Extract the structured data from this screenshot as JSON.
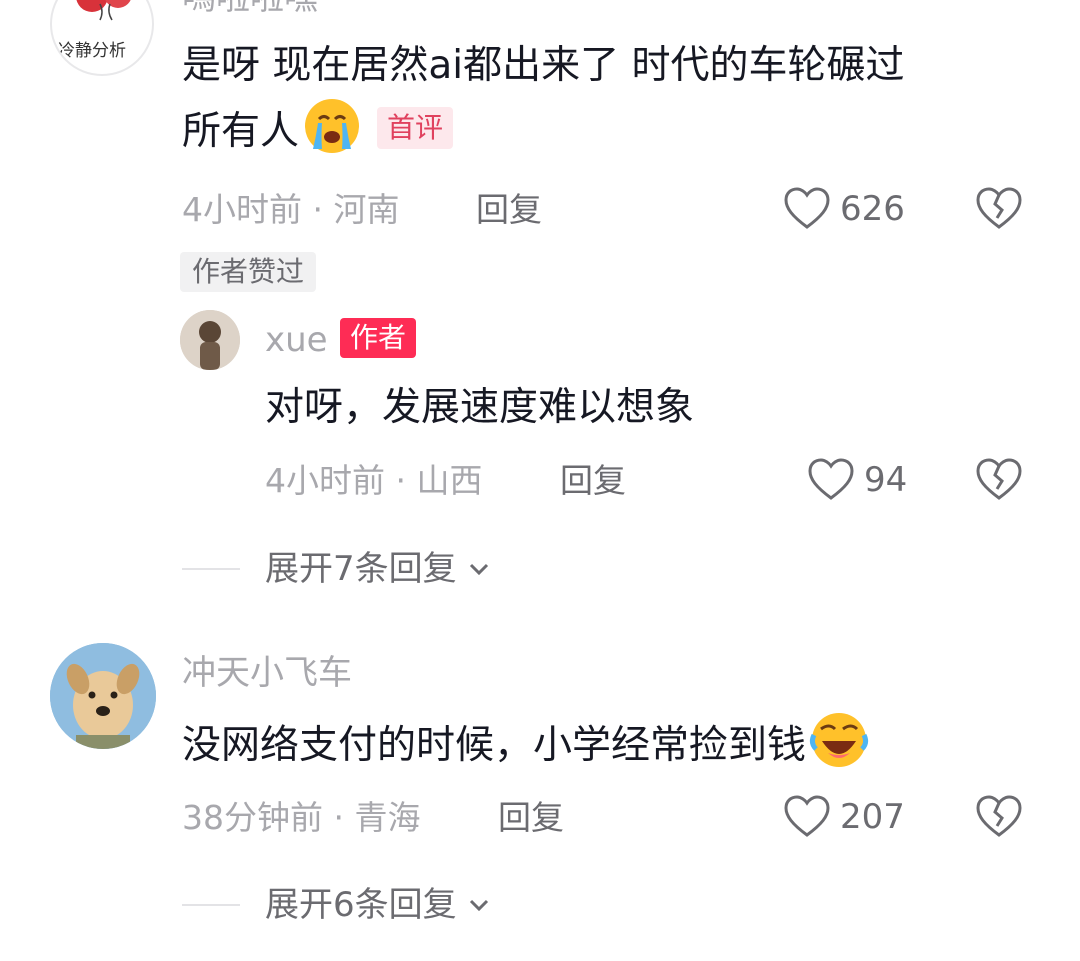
{
  "comments": [
    {
      "username": "嗎啦啦嘿",
      "avatar_text": "冷静分析",
      "text_line1": "是呀 现在居然ai都出来了 时代的车轮碾过",
      "text_line2": "所有人",
      "emoji": "crying-face",
      "tag": "首评",
      "meta": "4小时前 · 河南",
      "reply_label": "回复",
      "likes": "626",
      "liked_by_author_tag": "作者赞过",
      "replies": [
        {
          "username": "xue",
          "author_tag": "作者",
          "text": "对呀，发展速度难以想象",
          "meta": "4小时前 · 山西",
          "reply_label": "回复",
          "likes": "94"
        }
      ],
      "expand_label": "展开7条回复"
    },
    {
      "username": "冲天小飞车",
      "text": "没网络支付的时候，小学经常捡到钱",
      "emoji": "laughing-face",
      "meta": "38分钟前 · 青海",
      "reply_label": "回复",
      "likes": "207",
      "expand_label": "展开6条回复"
    }
  ],
  "colors": {
    "text_primary": "#161823",
    "text_secondary": "#a8a8ad",
    "action": "#6b6b70",
    "author_tag_bg": "#fe2c55",
    "first_tag_bg": "#fde8ec",
    "first_tag_text": "#e0415e"
  },
  "icons": [
    "heart-outline-icon",
    "broken-heart-icon",
    "chevron-down-icon"
  ]
}
